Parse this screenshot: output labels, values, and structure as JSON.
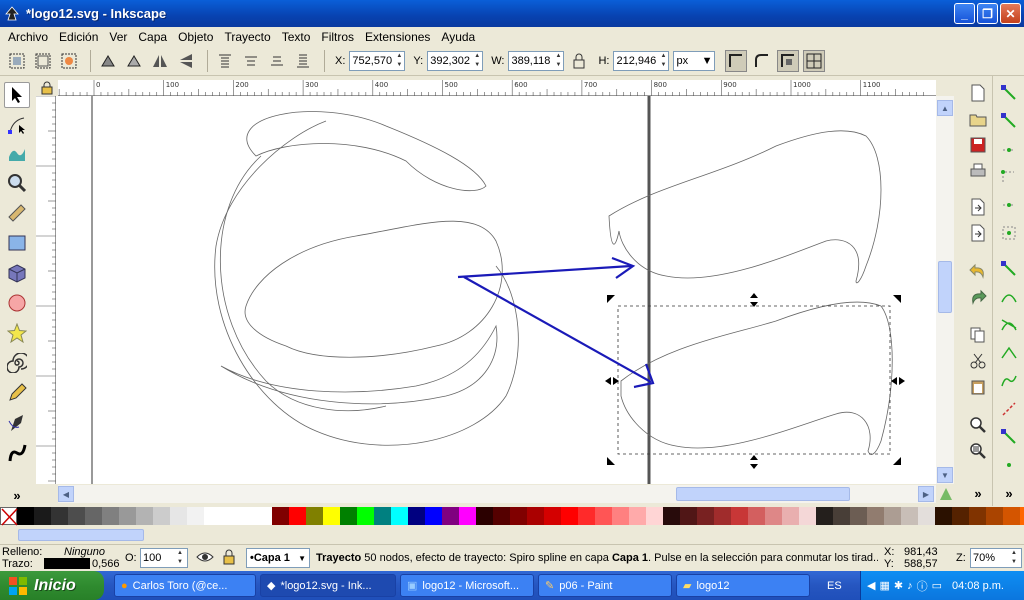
{
  "window": {
    "title": "*logo12.svg - Inkscape"
  },
  "menu": [
    "Archivo",
    "Edición",
    "Ver",
    "Capa",
    "Objeto",
    "Trayecto",
    "Texto",
    "Filtros",
    "Extensiones",
    "Ayuda"
  ],
  "toolbar": {
    "x_label": "X:",
    "x_value": "752,570",
    "y_label": "Y:",
    "y_value": "392,302",
    "w_label": "W:",
    "w_value": "389,118",
    "h_label": "H:",
    "h_value": "212,946",
    "unit": "px"
  },
  "ruler_ticks": [
    "-100",
    "0",
    "100",
    "200",
    "300",
    "400",
    "500",
    "600",
    "700",
    "800",
    "900",
    "1000",
    "1100"
  ],
  "colors": {
    "selection_arrow": "#1a1ab8",
    "guide": "#555555",
    "accent": "#0a5fd8"
  },
  "palette": [
    "#000000",
    "#1a1a1a",
    "#333333",
    "#4d4d4d",
    "#666666",
    "#808080",
    "#999999",
    "#b3b3b3",
    "#cccccc",
    "#e6e6e6",
    "#f2f2f2",
    "#ffffff",
    "#ffffff",
    "#ffffff",
    "#ffffff",
    "#800000",
    "#ff0000",
    "#808000",
    "#ffff00",
    "#008000",
    "#00ff00",
    "#008080",
    "#00ffff",
    "#000080",
    "#0000ff",
    "#800080",
    "#ff00ff",
    "#2b0000",
    "#550000",
    "#800000",
    "#aa0000",
    "#d40000",
    "#ff0000",
    "#ff2a2a",
    "#ff5555",
    "#ff8080",
    "#ffaaaa",
    "#ffd5d5",
    "#280b0b",
    "#501616",
    "#782121",
    "#a02c2c",
    "#c83737",
    "#d35f5f",
    "#de8787",
    "#e9afaf",
    "#f4d7d7",
    "#241f1c",
    "#483e37",
    "#6c5d53",
    "#917c6f",
    "#ac9d93",
    "#c8beb7",
    "#e3dedb",
    "#2b1100",
    "#552200",
    "#803300",
    "#aa4400",
    "#d45500",
    "#ff6600"
  ],
  "status": {
    "fill_label": "Relleno:",
    "fill_value": "Ninguno",
    "stroke_label": "Trazo:",
    "stroke_width": "0,566",
    "opacity_label": "O:",
    "opacity_value": "100",
    "layer": "•Capa 1",
    "message_bold": "Trayecto",
    "message": " 50 nodos, efecto de trayecto: Spiro spline en capa ",
    "message_layer": "Capa 1",
    "message_tail": ". Pulse en la selección para conmutar los tirad...",
    "coord_x_label": "X:",
    "coord_x": "981,43",
    "coord_y_label": "Y:",
    "coord_y": "588,57",
    "zoom_label": "Z:",
    "zoom": "70%"
  },
  "taskbar": {
    "start": "Inicio",
    "items": [
      "Carlos Toro (@ce...",
      "*logo12.svg - Ink...",
      "logo12 - Microsoft...",
      "p06 - Paint",
      "logo12"
    ],
    "lang": "ES",
    "time": "04:08 p.m."
  }
}
